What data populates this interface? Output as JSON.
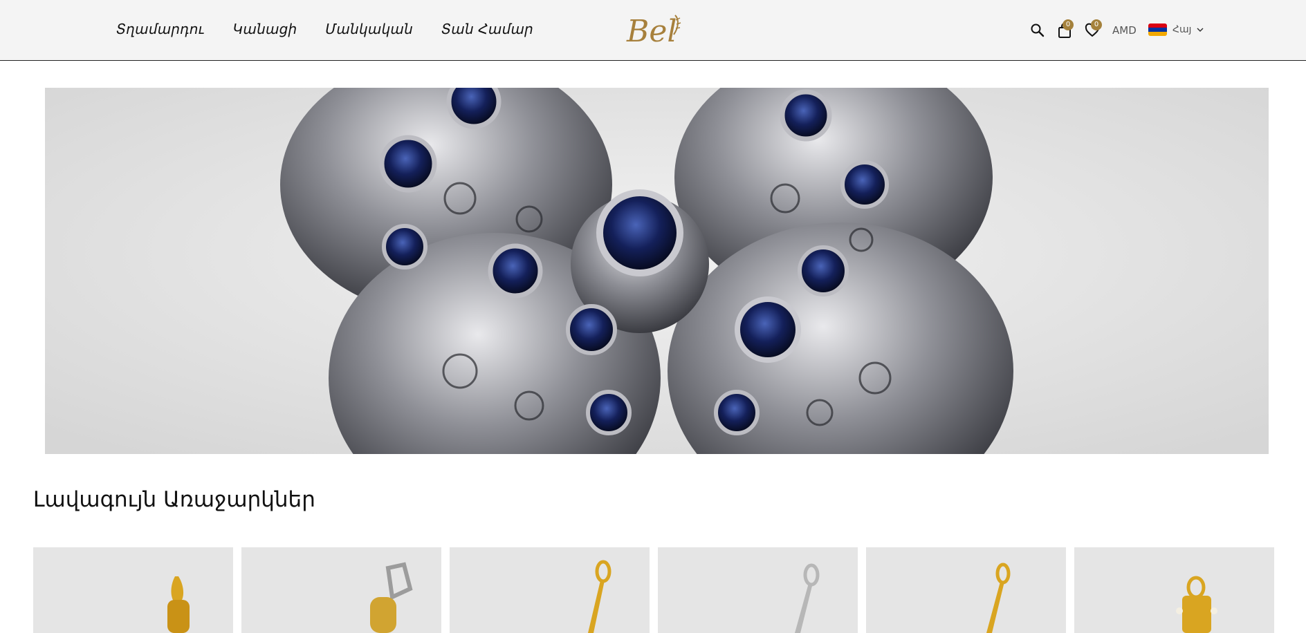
{
  "header": {
    "nav": [
      {
        "label": "Տղամարդու"
      },
      {
        "label": "Կանացի"
      },
      {
        "label": "Մանկական"
      },
      {
        "label": "Տան Համար"
      }
    ],
    "logo_text": "Bel",
    "cart_count": "0",
    "wishlist_count": "0",
    "currency": "AMD",
    "language": "Հայ"
  },
  "hero": {
    "image_icon": "jewelry-brooch-image"
  },
  "section": {
    "title": "Լավագույն Առաջարկներ"
  },
  "products": [
    {
      "color": "gold"
    },
    {
      "color": "white-gold"
    },
    {
      "color": "gold"
    },
    {
      "color": "silver"
    },
    {
      "color": "gold"
    },
    {
      "color": "gold"
    }
  ],
  "colors": {
    "accent": "#a4813b",
    "header_bg": "#f4f4f4",
    "gold": "#d9a521",
    "silver": "#b7b7b7"
  }
}
